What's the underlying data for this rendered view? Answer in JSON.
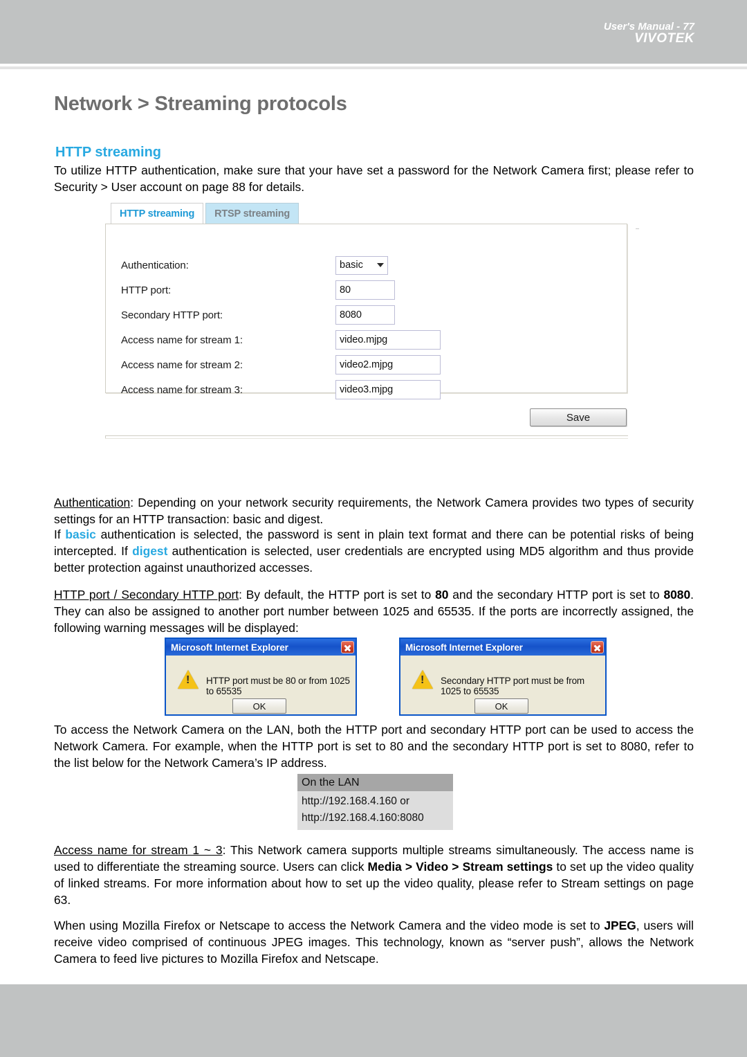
{
  "header": {
    "brand": "VIVOTEK"
  },
  "page": {
    "title": "Network > Streaming protocols",
    "section_heading": "HTTP streaming",
    "intro": "To utilize HTTP authentication, make sure that your have set a password for the Network Camera first; please refer to Security > User account on page 88 for details."
  },
  "settings_panel": {
    "tabs": [
      {
        "label": "HTTP streaming",
        "active": true
      },
      {
        "label": "RTSP streaming",
        "active": false
      }
    ],
    "fields": [
      {
        "label": "Authentication:",
        "value": "basic",
        "type": "select"
      },
      {
        "label": "HTTP port:",
        "value": "80",
        "type": "text-narrow"
      },
      {
        "label": "Secondary HTTP port:",
        "value": "8080",
        "type": "text-narrow"
      },
      {
        "label": "Access name for stream 1:",
        "value": "video.mjpg",
        "type": "text-wide"
      },
      {
        "label": "Access name for stream 2:",
        "value": "video2.mjpg",
        "type": "text-wide"
      },
      {
        "label": "Access name for stream 3:",
        "value": "video3.mjpg",
        "type": "text-wide"
      }
    ],
    "save_label": "Save"
  },
  "paragraphs": {
    "auth_term": "Authentication",
    "auth_body_1": ": Depending on your network security requirements, the Network Camera provides two types of security settings for an HTTP transaction: basic and digest.",
    "auth_body_2_pre": "If ",
    "auth_basic": "basic",
    "auth_body_2_mid": " authentication is selected, the password is sent in plain text format and there can be potential risks of being intercepted. If ",
    "auth_digest": "digest",
    "auth_body_2_post": " authentication is selected, user credentials are encrypted using MD5 algorithm and thus provide better protection against unauthorized accesses.",
    "port_term": "HTTP port / Secondary HTTP port",
    "port_body_a": ": By default, the HTTP port is set to ",
    "port_default": "80",
    "port_body_b": " and the secondary HTTP port is set to ",
    "port_secondary_default": "8080",
    "port_body_c": ". They can also be assigned to another port number between 1025 and 65535. If the ports are incorrectly assigned, the following warning messages will be displayed:",
    "lan_body": "To access the Network Camera on the LAN, both the HTTP port and secondary HTTP port can be used to access the Network Camera. For example, when the HTTP port is set to 80 and the secondary HTTP port is set to 8080, refer to the list below for the Network Camera’s IP address.",
    "stream_term": "Access name for stream 1 ~ 3",
    "stream_body_a": ": This Network camera supports multiple streams simultaneously. The access name is used to differentiate the streaming source. Users can click ",
    "stream_bold_1": "Media > Video > Stream settings",
    "stream_body_b": " to set up the video quality of linked streams. For more information about how to set up the video quality, please refer to Stream settings on page 63.",
    "firefox_body_a": "When using Mozilla Firefox or Netscape to access the Network Camera and the video mode is set to ",
    "firefox_bold": "JPEG",
    "firefox_body_b": ", users will receive video comprised of continuous JPEG images. This technology, known as “server push”, allows the Network Camera to feed live pictures to Mozilla Firefox and Netscape."
  },
  "dialogs": [
    {
      "title": "Microsoft Internet Explorer",
      "message": "HTTP port must be 80 or from 1025 to 65535",
      "ok_label": "OK",
      "close_icon": "close-icon",
      "warn_icon": "warning-icon"
    },
    {
      "title": "Microsoft Internet Explorer",
      "message": "Secondary HTTP port must be from 1025 to 65535",
      "ok_label": "OK",
      "close_icon": "close-icon",
      "warn_icon": "warning-icon"
    }
  ],
  "lan_table": {
    "header": "On the LAN",
    "line1": "http://192.168.4.160  or",
    "line2": "http://192.168.4.160:8080"
  },
  "footer": {
    "text": "User's Manual - 77"
  },
  "colors": {
    "accent_blue": "#29a9e1",
    "header_gray": "#c0c2c2",
    "title_gray": "#6e6e6e",
    "tab_inactive_bg": "#c3e5f5",
    "lan_header_bg": "#a6a6a6",
    "lan_body_bg": "#dddddd",
    "dialog_title_blue": "#1552c9",
    "dialog_close_red": "#c93b22"
  }
}
